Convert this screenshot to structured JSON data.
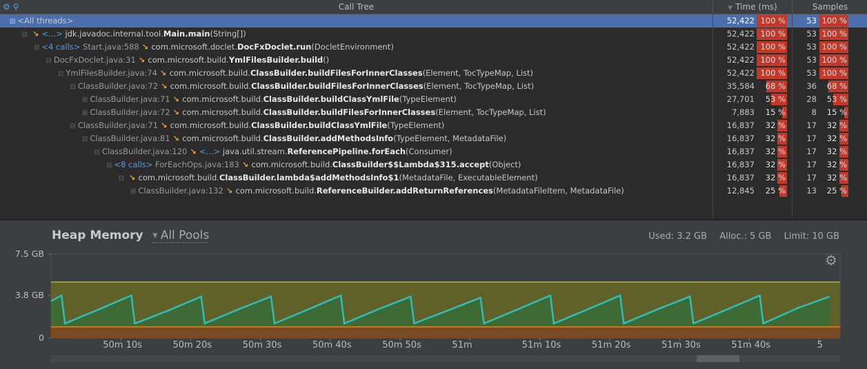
{
  "call_tree": {
    "title": "Call Tree",
    "tools_icons": "⚙ 🔍",
    "col_time": "Time (ms)",
    "col_samples": "Samples",
    "rows": [
      {
        "indent": 0,
        "expander": "⊟",
        "calls": "",
        "loc": "",
        "arrow": false,
        "prefix": "",
        "pkg": "<All threads>",
        "cls": "",
        "args": "",
        "time": "52,422",
        "time_pct": 100,
        "time_pct_label": "100 %",
        "samples": "53",
        "samp_pct": 100,
        "samp_pct_label": "100 %"
      },
      {
        "indent": 1,
        "expander": "⊟",
        "calls": "",
        "loc": "",
        "arrow": true,
        "prefix": "<...>",
        "pkg": "jdk.javadoc.internal.tool.",
        "cls": "Main.main",
        "args": "(String[])",
        "time": "52,422",
        "time_pct": 100,
        "time_pct_label": "100 %",
        "samples": "53",
        "samp_pct": 100,
        "samp_pct_label": "100 %"
      },
      {
        "indent": 2,
        "expander": "⊟",
        "calls": "<4 calls>",
        "loc": "Start.java:588",
        "arrow": true,
        "prefix": "",
        "pkg": "com.microsoft.doclet.",
        "cls": "DocFxDoclet.run",
        "args": "(DocletEnvironment)",
        "time": "52,422",
        "time_pct": 100,
        "time_pct_label": "100 %",
        "samples": "53",
        "samp_pct": 100,
        "samp_pct_label": "100 %"
      },
      {
        "indent": 3,
        "expander": "⊟",
        "calls": "",
        "loc": "DocFxDoclet.java:31",
        "arrow": true,
        "prefix": "",
        "pkg": "com.microsoft.build.",
        "cls": "YmlFilesBuilder.build",
        "args": "()",
        "time": "52,422",
        "time_pct": 100,
        "time_pct_label": "100 %",
        "samples": "53",
        "samp_pct": 100,
        "samp_pct_label": "100 %"
      },
      {
        "indent": 4,
        "expander": "⊟",
        "calls": "",
        "loc": "YmlFilesBuilder.java:74",
        "arrow": true,
        "prefix": "",
        "pkg": "com.microsoft.build.",
        "cls": "ClassBuilder.buildFilesForInnerClasses",
        "args": "(Element, TocTypeMap, List)",
        "time": "52,422",
        "time_pct": 100,
        "time_pct_label": "100 %",
        "samples": "53",
        "samp_pct": 100,
        "samp_pct_label": "100 %"
      },
      {
        "indent": 5,
        "expander": "⊟",
        "calls": "",
        "loc": "ClassBuilder.java:72",
        "arrow": true,
        "prefix": "",
        "pkg": "com.microsoft.build.",
        "cls": "ClassBuilder.buildFilesForInnerClasses",
        "args": "(Element, TocTypeMap, List)",
        "time": "35,584",
        "time_pct": 68,
        "time_pct_label": "68 %",
        "samples": "36",
        "samp_pct": 68,
        "samp_pct_label": "68 %"
      },
      {
        "indent": 6,
        "expander": "⊞",
        "calls": "",
        "loc": "ClassBuilder.java:71",
        "arrow": true,
        "prefix": "",
        "pkg": "com.microsoft.build.",
        "cls": "ClassBuilder.buildClassYmlFile",
        "args": "(TypeElement)",
        "time": "27,701",
        "time_pct": 53,
        "time_pct_label": "53 %",
        "samples": "28",
        "samp_pct": 53,
        "samp_pct_label": "53 %"
      },
      {
        "indent": 6,
        "expander": "⊞",
        "calls": "",
        "loc": "ClassBuilder.java:72",
        "arrow": true,
        "prefix": "",
        "pkg": "com.microsoft.build.",
        "cls": "ClassBuilder.buildFilesForInnerClasses",
        "args": "(Element, TocTypeMap, List)",
        "time": "7,883",
        "time_pct": 15,
        "time_pct_label": "15 %",
        "samples": "8",
        "samp_pct": 15,
        "samp_pct_label": "15 %"
      },
      {
        "indent": 5,
        "expander": "⊟",
        "calls": "",
        "loc": "ClassBuilder.java:71",
        "arrow": true,
        "prefix": "",
        "pkg": "com.microsoft.build.",
        "cls": "ClassBuilder.buildClassYmlFile",
        "args": "(TypeElement)",
        "time": "16,837",
        "time_pct": 32,
        "time_pct_label": "32 %",
        "samples": "17",
        "samp_pct": 32,
        "samp_pct_label": "32 %"
      },
      {
        "indent": 6,
        "expander": "⊟",
        "calls": "",
        "loc": "ClassBuilder.java:81",
        "arrow": true,
        "prefix": "",
        "pkg": "com.microsoft.build.",
        "cls": "ClassBuilder.addMethodsInfo",
        "args": "(TypeElement, MetadataFile)",
        "time": "16,837",
        "time_pct": 32,
        "time_pct_label": "32 %",
        "samples": "17",
        "samp_pct": 32,
        "samp_pct_label": "32 %"
      },
      {
        "indent": 7,
        "expander": "⊟",
        "calls": "",
        "loc": "ClassBuilder.java:120",
        "arrow": true,
        "prefix": "<...>",
        "pkg": "java.util.stream.",
        "cls": "ReferencePipeline.forEach",
        "args": "(Consumer)",
        "time": "16,837",
        "time_pct": 32,
        "time_pct_label": "32 %",
        "samples": "17",
        "samp_pct": 32,
        "samp_pct_label": "32 %"
      },
      {
        "indent": 8,
        "expander": "⊟",
        "calls": "<8 calls>",
        "loc": "ForEachOps.java:183",
        "arrow": true,
        "prefix": "",
        "pkg": "com.microsoft.build.",
        "cls": "ClassBuilder$$Lambda$315.accept",
        "args": "(Object)",
        "time": "16,837",
        "time_pct": 32,
        "time_pct_label": "32 %",
        "samples": "17",
        "samp_pct": 32,
        "samp_pct_label": "32 %"
      },
      {
        "indent": 9,
        "expander": "⊟",
        "calls": "",
        "loc": "",
        "arrow": true,
        "prefix": "",
        "pkg": "com.microsoft.build.",
        "cls": "ClassBuilder.lambda$addMethodsInfo$1",
        "args": "(MetadataFile, ExecutableElement)",
        "time": "16,837",
        "time_pct": 32,
        "time_pct_label": "32 %",
        "samples": "17",
        "samp_pct": 32,
        "samp_pct_label": "32 %"
      },
      {
        "indent": 10,
        "expander": "⊞",
        "calls": "",
        "loc": "ClassBuilder.java:132",
        "arrow": true,
        "prefix": "",
        "pkg": "com.microsoft.build.",
        "cls": "ReferenceBuilder.addReturnReferences",
        "args": "(MetadataFileItem, MetadataFile)",
        "time": "12,845",
        "time_pct": 25,
        "time_pct_label": "25 %",
        "samples": "13",
        "samp_pct": 25,
        "samp_pct_label": "25 %"
      }
    ]
  },
  "heap": {
    "title": "Heap Memory",
    "pools": "All Pools",
    "used": "Used: 3.2 GB",
    "alloc": "Alloc.: 5 GB",
    "limit": "Limit: 10 GB",
    "settings_icon": "gear-icon",
    "y_labels": [
      "7.5 GB",
      "3.8 GB",
      "0"
    ],
    "x_labels": [
      "50m 10s",
      "50m 20s",
      "50m 30s",
      "50m 40s",
      "50m 50s",
      "51m",
      "51m 10s",
      "51m 20s",
      "51m 30s",
      "51m 40s",
      "5"
    ],
    "colors": {
      "used_line": "#2fbfb8",
      "used_fill": "#3e6a35",
      "alloc_band": "#5f6129",
      "limit_line": "#b8b42a",
      "floor_band": "#7a4a22",
      "floor_line": "#d08a2a"
    }
  },
  "chart_data": {
    "type": "line",
    "title": "Heap Memory",
    "ylabel": "",
    "xlabel": "",
    "y_ticks": [
      "0",
      "3.8 GB",
      "7.5 GB"
    ],
    "ylim_gb": [
      0,
      7.5
    ],
    "x_ticks": [
      "50m 10s",
      "50m 20s",
      "50m 30s",
      "50m 40s",
      "50m 50s",
      "51m",
      "51m 10s",
      "51m 20s",
      "51m 30s",
      "51m 40s"
    ],
    "allocated_gb": 5,
    "floor_gb": 1.0,
    "series": [
      {
        "x_seconds": [
          3000,
          3001.5,
          3002,
          3007,
          3011.5,
          3012,
          3017,
          3021.5,
          3022,
          3027,
          3031.5,
          3032,
          3037,
          3041.5,
          3042,
          3047,
          3051.5,
          3052,
          3057,
          3061.5,
          3062,
          3067,
          3071.5,
          3072,
          3077,
          3081.5,
          3082,
          3087,
          3091.5,
          3092,
          3097,
          3101.5,
          3102,
          3107,
          3111.5
        ],
        "values_gb": [
          3.3,
          3.8,
          1.3,
          2.6,
          3.8,
          1.3,
          2.5,
          3.7,
          1.3,
          2.6,
          3.7,
          1.3,
          2.6,
          3.8,
          1.3,
          2.6,
          3.7,
          1.3,
          2.5,
          3.6,
          1.3,
          2.6,
          3.8,
          1.3,
          2.6,
          3.8,
          1.3,
          2.6,
          3.7,
          1.3,
          2.6,
          3.8,
          1.3,
          2.7,
          3.7
        ]
      }
    ]
  }
}
